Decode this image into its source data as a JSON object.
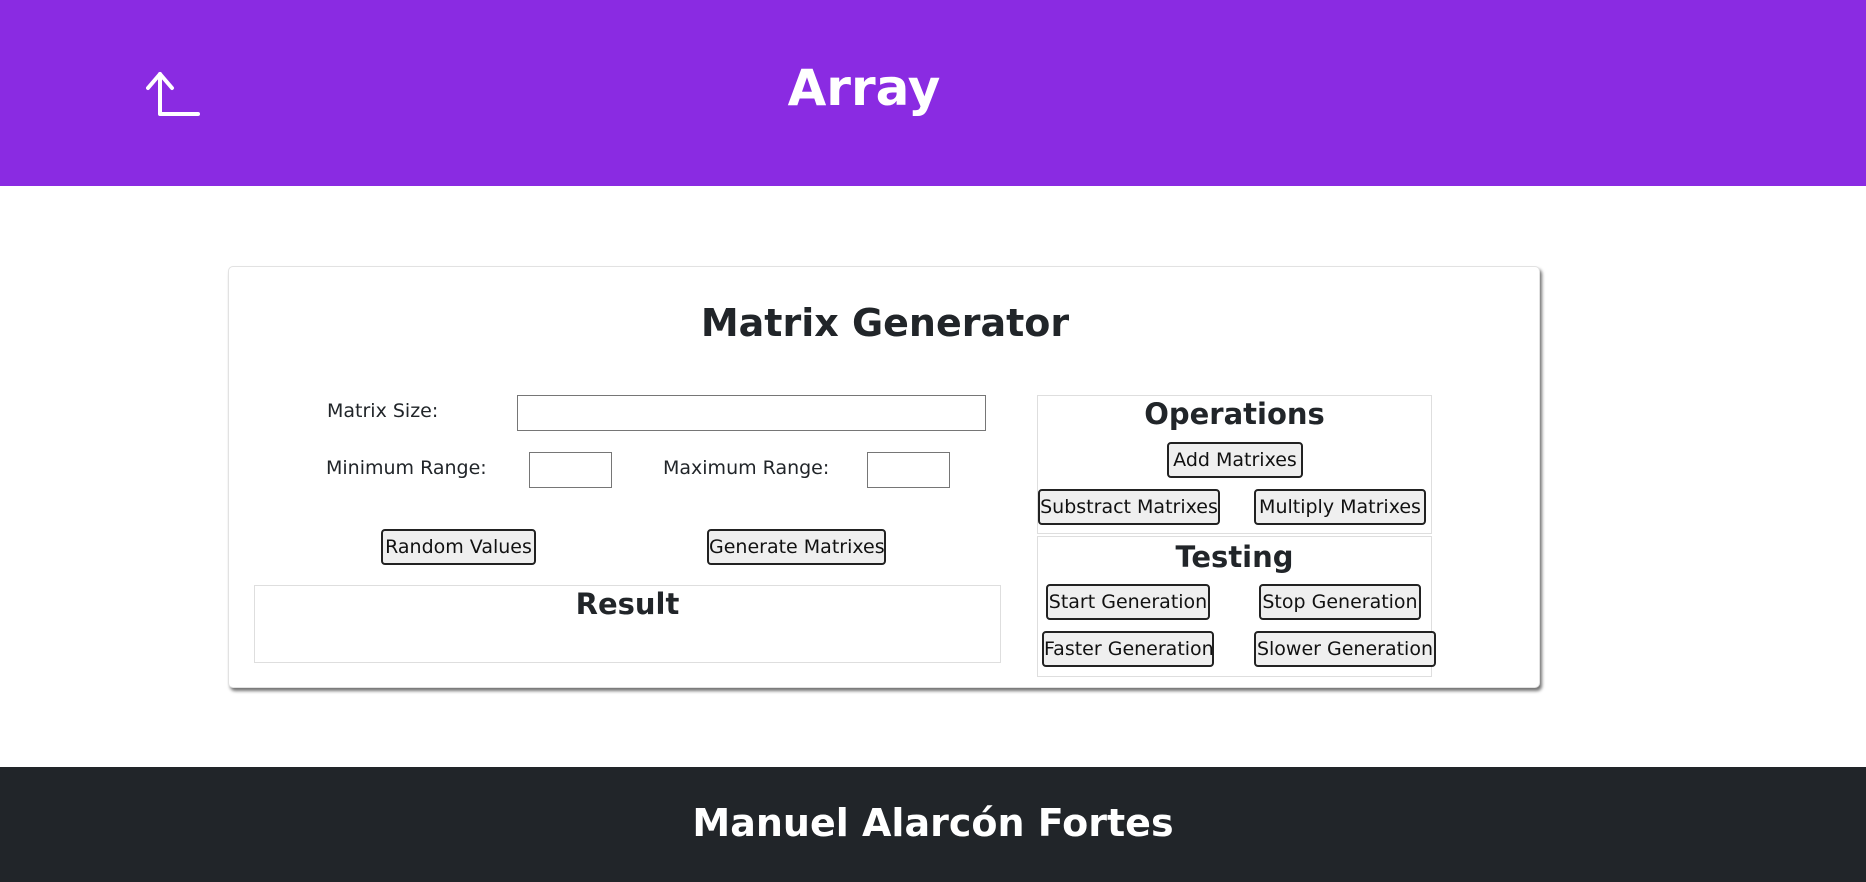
{
  "header": {
    "title": "Array",
    "back_icon": "arrow-up-left-corner-icon",
    "background": "#8a2be2"
  },
  "card": {
    "title": "Matrix Generator",
    "matrix_size_label": "Matrix Size:",
    "matrix_size_value": "",
    "min_range_label": "Minimum Range:",
    "min_range_value": "",
    "max_range_label": "Maximum Range:",
    "max_range_value": "",
    "random_values_label": "Random Values",
    "generate_matrixes_label": "Generate Matrixes",
    "result_title": "Result"
  },
  "operations": {
    "title": "Operations",
    "add_label": "Add Matrixes",
    "subtract_label": "Substract Matrixes",
    "multiply_label": "Multiply Matrixes"
  },
  "testing": {
    "title": "Testing",
    "start_label": "Start Generation",
    "stop_label": "Stop Generation",
    "faster_label": "Faster Generation",
    "slower_label": "Slower Generation"
  },
  "footer": {
    "author": "Manuel Alarcón Fortes",
    "background": "#212529"
  }
}
